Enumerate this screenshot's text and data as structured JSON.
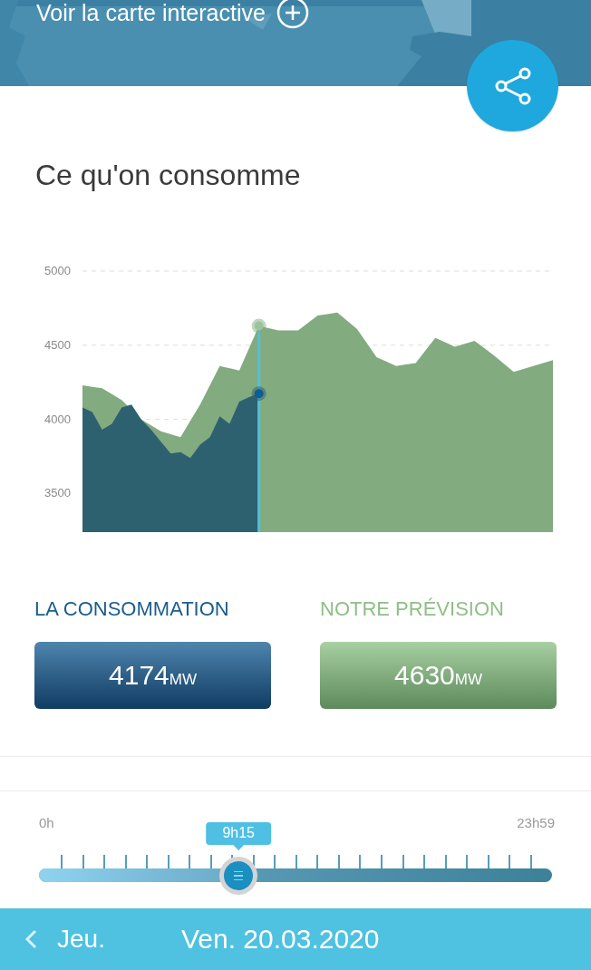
{
  "banner": {
    "link": "Voir la carte interactive"
  },
  "section": {
    "title": "Ce qu'on consomme"
  },
  "chart_data": {
    "type": "area",
    "ylim": [
      3240,
      5000
    ],
    "yticks": [
      3500,
      4000,
      4500,
      5000
    ],
    "categories": [
      null,
      null,
      null,
      null,
      null,
      null,
      null,
      null,
      null,
      null,
      null,
      null,
      null,
      null,
      null,
      null,
      null,
      null,
      null,
      null,
      null,
      null,
      null,
      null,
      null,
      null,
      null,
      null,
      null,
      null,
      null,
      null,
      null,
      null,
      null,
      null,
      null,
      null,
      null,
      null,
      null,
      null,
      null,
      null,
      null,
      null,
      null,
      null,
      null
    ],
    "series": [
      {
        "color": "#82ab80",
        "values": [
          4230,
          4220,
          4210,
          4170,
          4130,
          4065,
          4000,
          3960,
          3920,
          3900,
          3880,
          3990,
          4100,
          4230,
          4360,
          4345,
          4330,
          4480,
          4630,
          4615,
          4600,
          4600,
          4600,
          4650,
          4700,
          4710,
          4720,
          4665,
          4610,
          4515,
          4420,
          4390,
          4360,
          4370,
          4380,
          4465,
          4550,
          4520,
          4490,
          4510,
          4530,
          4480,
          4430,
          4375,
          4320,
          4340,
          4360,
          4380,
          4400
        ]
      },
      {
        "color": "#2e6170",
        "values": [
          4080,
          4050,
          3930,
          3970,
          4080,
          4100,
          4000,
          3930,
          3850,
          3770,
          3780,
          3740,
          3830,
          3880,
          4020,
          3970,
          4120,
          4150,
          4174,
          null,
          null,
          null,
          null,
          null,
          null,
          null,
          null,
          null,
          null,
          null,
          null,
          null,
          null,
          null,
          null,
          null,
          null,
          null,
          null,
          null,
          null,
          null,
          null,
          null,
          null,
          null,
          null,
          null,
          null
        ]
      }
    ]
  },
  "readings": [
    {
      "label": "LA CONSOMMATION",
      "value": "4174",
      "unit": "MW",
      "kind": "actual"
    },
    {
      "label": "NOTRE PRÉVISION",
      "value": "4630",
      "unit": "MW",
      "kind": "forecast"
    }
  ],
  "time_slider": {
    "start": "0h",
    "end": "23h59",
    "current": "9h15",
    "level": 0.389
  },
  "footer": {
    "previous": "Jeu.",
    "date": "Ven. 20.03.2020"
  }
}
